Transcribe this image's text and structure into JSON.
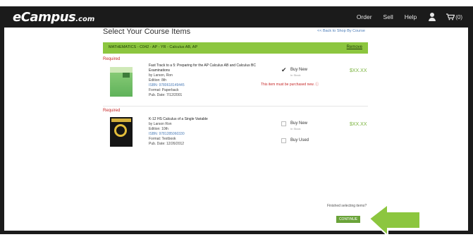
{
  "header": {
    "logo": "eCampus",
    "logo_suffix": ".com",
    "nav": [
      "Order",
      "Sell",
      "Help"
    ],
    "cart_count": "(0)"
  },
  "page": {
    "title": "Select Your Course Items",
    "back_link": "<< Back to Shop By Course"
  },
  "course": {
    "label": "MATHEMATICS - C042 - AP - YR - Calculus AB, AP",
    "remove": "Remove"
  },
  "items": [
    {
      "required": "Required",
      "title": "Fast Track to a 5: Preparing for the AP Calculus AB and Calculus BC Examinations",
      "author": "by Larson, Ron",
      "edition": "Edition: 8th",
      "isbn": "ISBN: 9780618149445",
      "format": "Format: Paperback",
      "pub_date": "Pub. Date: 7/12/2001",
      "option_label": "Buy New",
      "option_sub": "In Stock",
      "price": "$XX.XX",
      "must_note": "This item must be purchased new."
    },
    {
      "required": "Required",
      "title": "K-12 HS Calculus of a Single Variable",
      "author": "by Larson Ron",
      "edition": "Edition: 10th",
      "isbn": "ISBN: 9781285060330",
      "format": "Format: Textbook",
      "pub_date": "Pub. Date: 12/26/2012",
      "option_label": "Buy New",
      "option_sub": "In Stock",
      "price": "$XX.XX",
      "option2_label": "Buy Used"
    }
  ],
  "footer": {
    "finished": "Finished selecting items?",
    "continue": "CONTINUE"
  },
  "colors": {
    "accent_green": "#8cc63f",
    "button_green": "#6aa339",
    "required_red": "#c62828",
    "header_bg": "#1b1b1b"
  }
}
